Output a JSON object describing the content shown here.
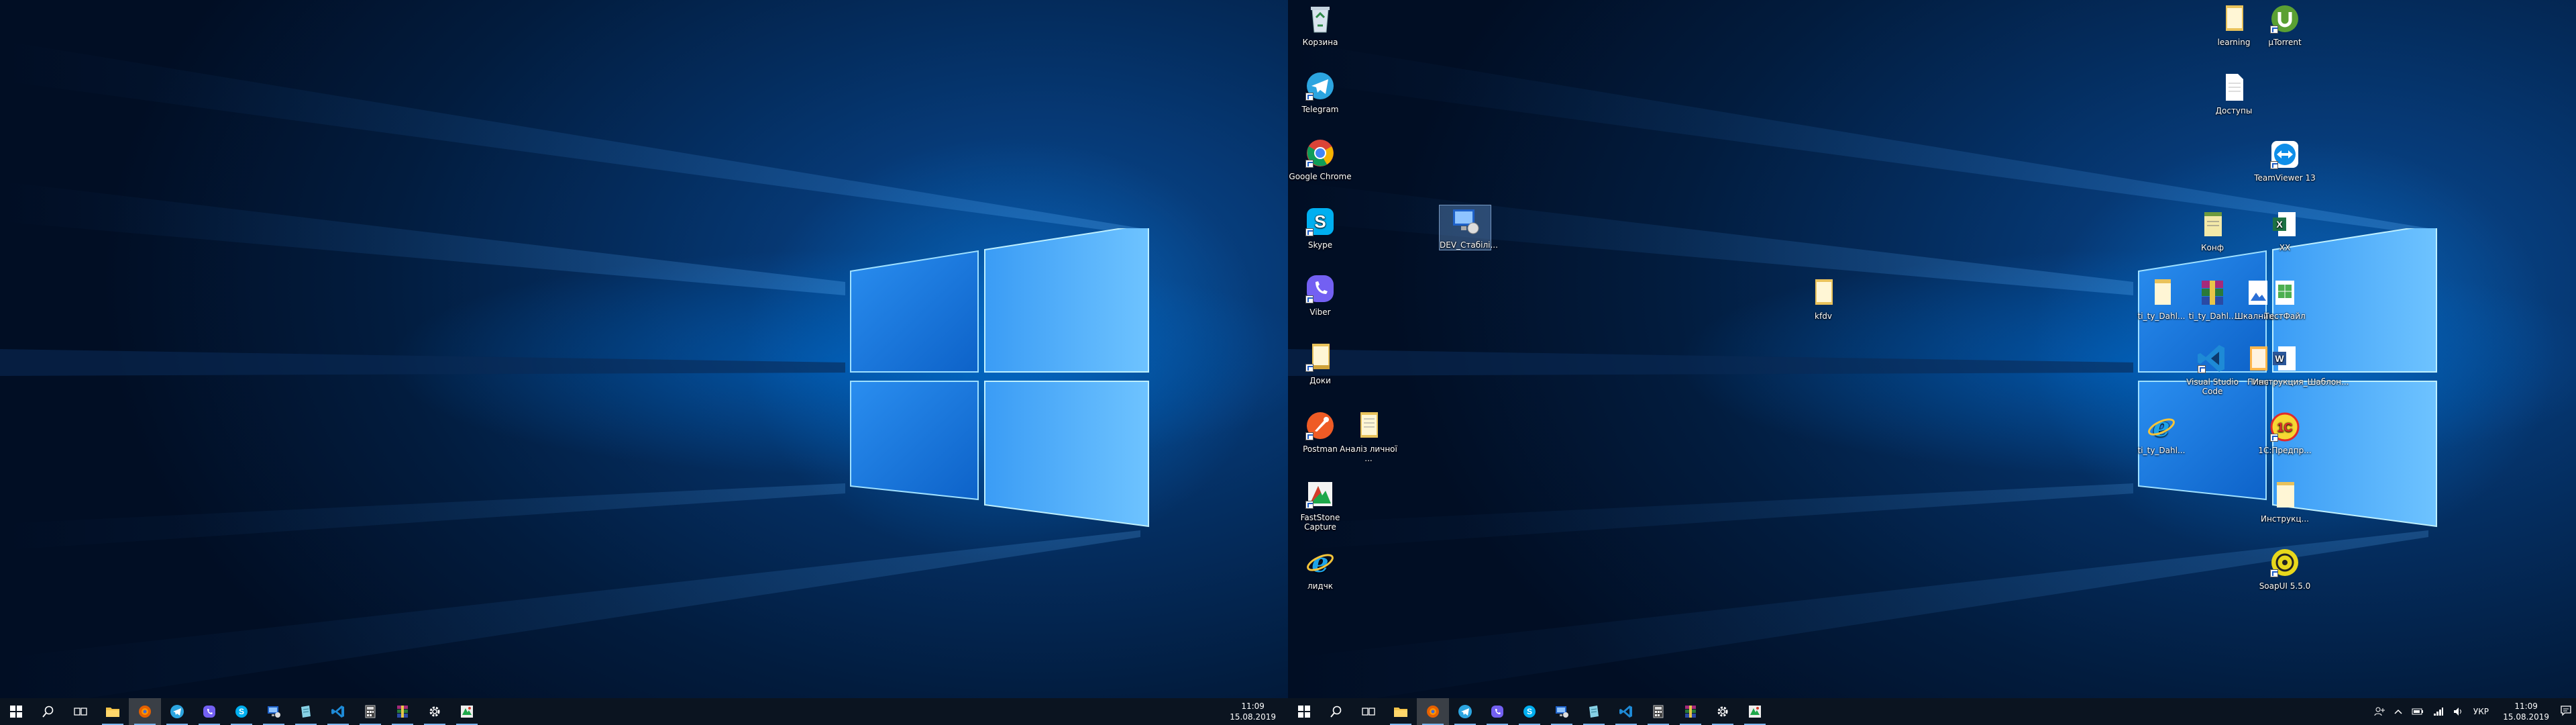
{
  "left_screen": {
    "taskbar": {
      "clock_time": "11:09",
      "clock_date": "15.08.2019"
    }
  },
  "right_screen": {
    "desktop_icons": [
      {
        "label": "Корзина",
        "icon": "recycle-bin-icon"
      },
      {
        "label": "Telegram",
        "icon": "telegram-icon"
      },
      {
        "label": "Google Chrome",
        "icon": "chrome-icon"
      },
      {
        "label": "Skype",
        "icon": "skype-icon"
      },
      {
        "label": "Viber",
        "icon": "viber-icon"
      },
      {
        "label": "Доки",
        "icon": "folder-icon"
      },
      {
        "label": "Postman",
        "icon": "postman-icon"
      },
      {
        "label": "Аналіз личної ...",
        "icon": "document-icon"
      },
      {
        "label": "FastStone Capture",
        "icon": "faststone-icon"
      },
      {
        "label": "лидчк",
        "icon": "internet-explorer-icon"
      },
      {
        "label": "DEV_Стабілі...",
        "icon": "remote-desktop-icon"
      },
      {
        "label": "kfdv",
        "icon": "document-icon"
      },
      {
        "label": "learning",
        "icon": "folder-icon"
      },
      {
        "label": "µTorrent",
        "icon": "utorrent-icon"
      },
      {
        "label": "Доступы",
        "icon": "text-file-icon"
      },
      {
        "label": "TeamViewer 13",
        "icon": "teamviewer-icon"
      },
      {
        "label": "Конф",
        "icon": "notepad-icon"
      },
      {
        "label": "XX",
        "icon": "excel-icon"
      },
      {
        "label": "ti_ty_Dahl...",
        "icon": "document-icon"
      },
      {
        "label": "ti_ty_Dahl...",
        "icon": "winrar-icon"
      },
      {
        "label": "Шкалнин...",
        "icon": "image-icon"
      },
      {
        "label": "ТестФайл",
        "icon": "spreadsheet-icon"
      },
      {
        "label": "Visual Studio Code",
        "icon": "vscode-icon"
      },
      {
        "label": "План",
        "icon": "document-icon"
      },
      {
        "label": "Инструкция_Шаблон...",
        "icon": "word-icon"
      },
      {
        "label": "ti_ty_Dahl...",
        "icon": "internet-explorer-icon"
      },
      {
        "label": "1С:Предпр...",
        "icon": "1c-icon"
      },
      {
        "label": "Инструкц...",
        "icon": "text-file-icon"
      },
      {
        "label": "SoapUI 5.5.0",
        "icon": "soapui-icon"
      }
    ],
    "taskbar": {
      "tray_language": "УКР",
      "clock_time": "11:09",
      "clock_date": "15.08.2019"
    }
  },
  "taskbar_apps": [
    {
      "name": "start",
      "icon": "windows-start-icon"
    },
    {
      "name": "search",
      "icon": "search-icon"
    },
    {
      "name": "task-view",
      "icon": "task-view-icon"
    },
    {
      "name": "explorer",
      "icon": "folder-icon"
    },
    {
      "name": "firefox",
      "icon": "browser-icon"
    },
    {
      "name": "telegram",
      "icon": "telegram-icon"
    },
    {
      "name": "viber",
      "icon": "viber-icon"
    },
    {
      "name": "skype",
      "icon": "skype-icon"
    },
    {
      "name": "remote",
      "icon": "remote-desktop-icon"
    },
    {
      "name": "notes",
      "icon": "notes-icon"
    },
    {
      "name": "vscode",
      "icon": "vscode-icon"
    },
    {
      "name": "calculator",
      "icon": "calculator-icon"
    },
    {
      "name": "winrar",
      "icon": "winrar-icon"
    },
    {
      "name": "settings",
      "icon": "gear-icon"
    },
    {
      "name": "faststone",
      "icon": "faststone-icon"
    }
  ]
}
